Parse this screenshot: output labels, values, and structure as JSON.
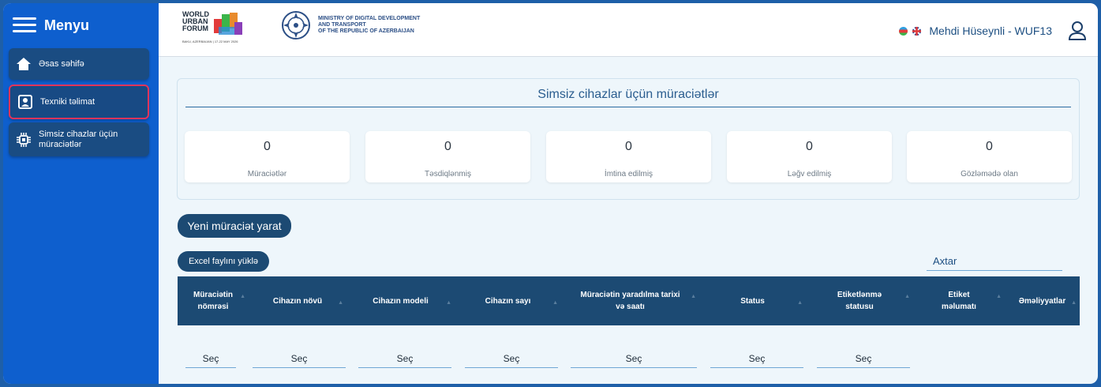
{
  "sidebar": {
    "title": "Menyu",
    "items": [
      {
        "label": "Əsas səhifə",
        "icon": "home-icon"
      },
      {
        "label": "Texniki təlimat",
        "icon": "user-manual-icon",
        "active": true
      },
      {
        "label_line1": "Simsiz cihazlar üçün",
        "label_line2": "müraciətlər",
        "icon": "chip-icon"
      }
    ]
  },
  "header": {
    "wuf_logo": {
      "line1": "WORLD",
      "line2": "URBAN",
      "line3": "FORUM",
      "small": "BAKU, AZERBAIJAN | 17-22 MAY 2026"
    },
    "ministry": {
      "line1": "MINISTRY OF DIGITAL DEVELOPMENT",
      "line2": "AND TRANSPORT",
      "line3": "OF THE REPUBLIC OF AZERBAIJAN"
    },
    "user_name": "Mehdi Hüseynli - WUF13"
  },
  "stats": {
    "title": "Simsiz cihazlar üçün müraciətlər",
    "cards": [
      {
        "value": "0",
        "label": "Müraciətlər"
      },
      {
        "value": "0",
        "label": "Təsdiqlənmiş"
      },
      {
        "value": "0",
        "label": "İmtina edilmiş"
      },
      {
        "value": "0",
        "label": "Ləğv edilmiş"
      },
      {
        "value": "0",
        "label": "Gözləmədə olan"
      }
    ]
  },
  "actions": {
    "new_request": "Yeni müraciət yarat",
    "excel_upload": "Excel faylını yüklə",
    "search_placeholder": "Axtar"
  },
  "table": {
    "columns": [
      {
        "line1": "Müraciətin",
        "line2": "nömrəsi"
      },
      {
        "line1": "Cihazın növü",
        "line2": ""
      },
      {
        "line1": "Cihazın modeli",
        "line2": ""
      },
      {
        "line1": "Cihazın sayı",
        "line2": ""
      },
      {
        "line1": "Müraciətin yaradılma tarixi",
        "line2": "və saatı"
      },
      {
        "line1": "Status",
        "line2": ""
      },
      {
        "line1": "Etiketlənmə",
        "line2": "statusu"
      },
      {
        "line1": "Etiket",
        "line2": "məlumatı"
      },
      {
        "line1": "Əməliyyatlar",
        "line2": ""
      }
    ],
    "filter_label": "Seç"
  }
}
